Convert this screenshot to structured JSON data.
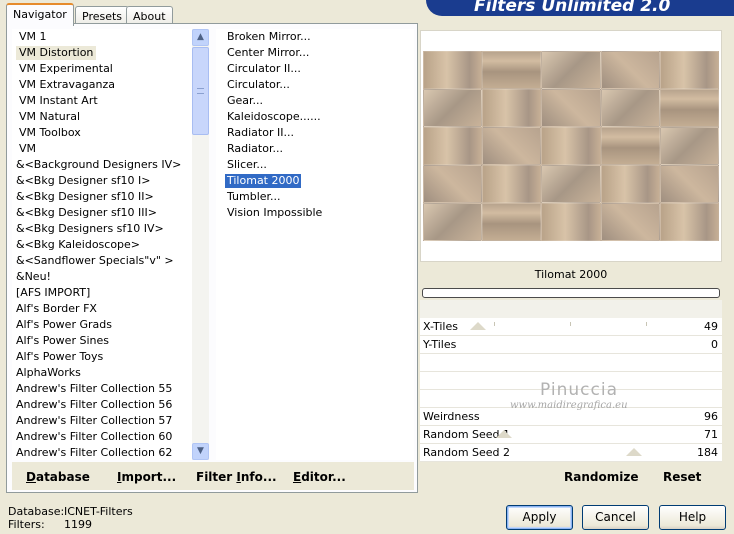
{
  "tabs": [
    {
      "label": "Navigator",
      "active": true
    },
    {
      "label": "Presets",
      "active": false
    },
    {
      "label": "About",
      "active": false
    }
  ],
  "banner": {
    "title": "Filters Unlimited 2.0"
  },
  "categories": [
    {
      "label": "VM 1",
      "selected": false
    },
    {
      "label": "VM Distortion",
      "selected": true
    },
    {
      "label": "VM Experimental",
      "selected": false
    },
    {
      "label": "VM Extravaganza",
      "selected": false
    },
    {
      "label": "VM Instant Art",
      "selected": false
    },
    {
      "label": "VM Natural",
      "selected": false
    },
    {
      "label": "VM Toolbox",
      "selected": false
    },
    {
      "label": "VM",
      "selected": false
    },
    {
      "label": "&<Background Designers IV>",
      "selected": false
    },
    {
      "label": "&<Bkg Designer sf10 I>",
      "selected": false
    },
    {
      "label": "&<Bkg Designer sf10 II>",
      "selected": false
    },
    {
      "label": "&<Bkg Designer sf10 III>",
      "selected": false
    },
    {
      "label": "&<Bkg Designers sf10 IV>",
      "selected": false
    },
    {
      "label": "&<Bkg Kaleidoscope>",
      "selected": false
    },
    {
      "label": "&<Sandflower Specials\"v\" >",
      "selected": false
    },
    {
      "label": "&Neu!",
      "selected": false
    },
    {
      "label": "[AFS IMPORT]",
      "selected": false
    },
    {
      "label": "Alf's Border FX",
      "selected": false
    },
    {
      "label": "Alf's Power Grads",
      "selected": false
    },
    {
      "label": "Alf's Power Sines",
      "selected": false
    },
    {
      "label": "Alf's Power Toys",
      "selected": false
    },
    {
      "label": "AlphaWorks",
      "selected": false
    },
    {
      "label": "Andrew's Filter Collection 55",
      "selected": false
    },
    {
      "label": "Andrew's Filter Collection 56",
      "selected": false
    },
    {
      "label": "Andrew's Filter Collection 57",
      "selected": false
    },
    {
      "label": "Andrew's Filter Collection 60",
      "selected": false
    },
    {
      "label": "Andrew's Filter Collection 62",
      "selected": false
    }
  ],
  "scrollbar": {
    "up_glyph": "▲",
    "down_glyph": "▼"
  },
  "filters": [
    {
      "label": "Broken Mirror...",
      "selected": false
    },
    {
      "label": "Center Mirror...",
      "selected": false
    },
    {
      "label": "Circulator II...",
      "selected": false
    },
    {
      "label": "Circulator...",
      "selected": false
    },
    {
      "label": "Gear...",
      "selected": false
    },
    {
      "label": "Kaleidoscope......",
      "selected": false
    },
    {
      "label": "Radiator II...",
      "selected": false
    },
    {
      "label": "Radiator...",
      "selected": false
    },
    {
      "label": "Slicer...",
      "selected": false
    },
    {
      "label": "Tilomat 2000",
      "selected": true
    },
    {
      "label": "Tumbler...",
      "selected": false
    },
    {
      "label": "Vision Impossible",
      "selected": false
    }
  ],
  "left_buttons": {
    "database": {
      "label": "Database",
      "accel": "D",
      "rest": "atabase"
    },
    "import": {
      "label": "Import...",
      "accel": "I",
      "rest": "mport..."
    },
    "filter_info": {
      "label": "Filter Info...",
      "pre": "Filter ",
      "accel": "I",
      "rest": "nfo..."
    },
    "editor": {
      "label": "Editor...",
      "accel": "E",
      "rest": "ditor..."
    }
  },
  "preview": {
    "filter_name": "Tilomat 2000",
    "progress": 0
  },
  "params": [
    {
      "label": "X-Tiles",
      "value": "49"
    },
    {
      "label": "Y-Tiles",
      "value": "0"
    },
    {
      "label": "",
      "value": ""
    },
    {
      "label": "",
      "value": ""
    },
    {
      "label": "",
      "value": ""
    },
    {
      "label": "Weirdness",
      "value": "96"
    },
    {
      "label": "Random Seed 1",
      "value": "71"
    },
    {
      "label": "Random Seed 2",
      "value": "184"
    }
  ],
  "watermark": {
    "name": "Pinuccia",
    "site": "www.maidiregrafica.eu"
  },
  "right_buttons": {
    "randomize": "Randomize",
    "reset": "Reset"
  },
  "status": {
    "database_label": "Database:",
    "database_value": "ICNET-Filters",
    "filters_label": "Filters:",
    "filters_value": "1199"
  },
  "dialog": {
    "apply": "Apply",
    "cancel": "Cancel",
    "help": "Help"
  }
}
